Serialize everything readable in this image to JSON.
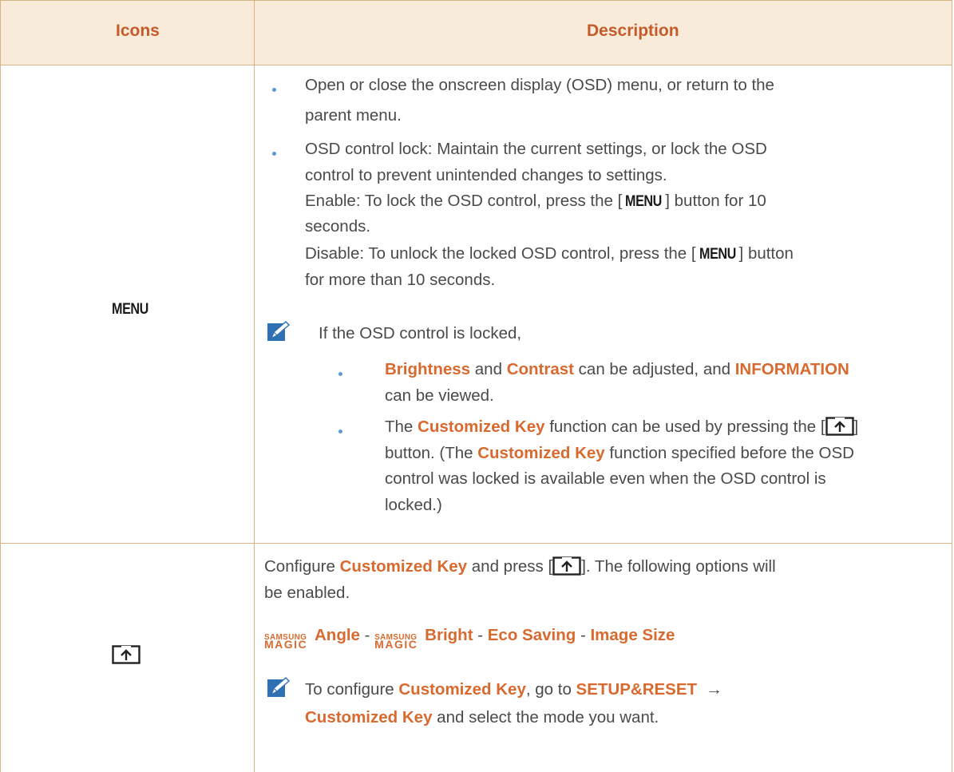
{
  "header": {
    "icons": "Icons",
    "description": "Description"
  },
  "rows": {
    "menu": {
      "icon_label": "MENU",
      "b1": "Open or close the onscreen display (OSD) menu, or return to the",
      "b1b": "parent menu.",
      "b2a": "OSD control lock: Maintain the current settings, or lock the OSD",
      "b2b": "control to prevent unintended changes to settings.",
      "en_pre": "Enable: To lock the OSD control, press the [",
      "en_key": "MENU",
      "en_post": "] button for 10",
      "en_cont": "seconds.",
      "dis_pre": "Disable: To unlock the locked OSD control, press the [",
      "dis_key": "MENU",
      "dis_post": "] button",
      "dis_cont": "for more than 10 seconds.",
      "note": "If the OSD control is locked,",
      "s1_brightness": "Brightness",
      "s1_and": " and ",
      "s1_contrast": "Contrast",
      "s1_mid": " can be adjusted, and ",
      "s1_info": "INFORMATION",
      "s1_end": "can be viewed.",
      "s2_pre": "The ",
      "s2_ck": "Customized Key",
      "s2_mid": " function can be used by pressing the [",
      "s2_post": "]",
      "s2_l2a": "button. (The ",
      "s2_l2b": "Customized Key",
      "s2_l2c": " function specified before the OSD",
      "s2_l3": "control was locked is available even when the OSD control is",
      "s2_l4": "locked.)"
    },
    "custom": {
      "icon_name": "customized-key-icon",
      "l1_pre": "Configure ",
      "l1_ck": "Customized Key",
      "l1_mid": " and press [",
      "l1_post": "]. The following options will",
      "l2": "be enabled.",
      "samsung": "SAMSUNG",
      "magic": "MAGIC",
      "opt_angle": "Angle",
      "opt_bright": "Bright",
      "opt_eco": "Eco Saving",
      "opt_image": "Image Size",
      "sep": " - ",
      "n_pre": "To configure ",
      "n_ck": "Customized Key",
      "n_mid": ", go to ",
      "n_setup": "SETUP&RESET",
      "n_arrow": "  →",
      "n_ck2": "Customized Key",
      "n_end": " and select the mode you want."
    }
  },
  "colors": {
    "accent": "#d86a2f",
    "header_bg": "#f8ebd9",
    "border": "#d7b483",
    "bullet": "#5a9bd5",
    "note_icon": "#2f6fb3"
  }
}
